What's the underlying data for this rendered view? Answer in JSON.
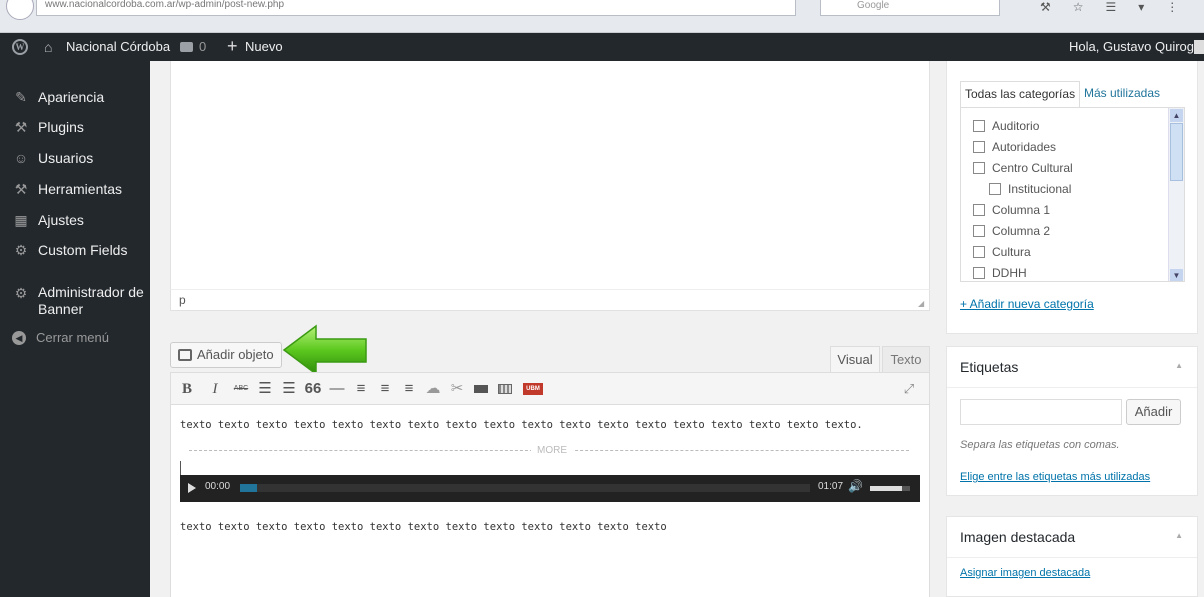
{
  "browser": {
    "url": "www.nacionalcordoba.com.ar/wp-admin/post-new.php",
    "search_placeholder": "Google",
    "toolbar_icons": [
      "tools-icon",
      "bookmark-icon",
      "menu-icon",
      "dropdown-icon",
      "more-icon"
    ]
  },
  "adminbar": {
    "site_name": "Nacional Córdoba",
    "comments_count": "0",
    "new_label": "Nuevo",
    "greeting": "Hola, Gustavo Quiroga"
  },
  "sidebar": {
    "items": [
      {
        "label": "Apariencia",
        "icon": "paintbrush-icon"
      },
      {
        "label": "Plugins",
        "icon": "plugin-icon"
      },
      {
        "label": "Usuarios",
        "icon": "users-icon"
      },
      {
        "label": "Herramientas",
        "icon": "wrench-icon"
      },
      {
        "label": "Ajustes",
        "icon": "settings-icon"
      },
      {
        "label": "Custom Fields",
        "icon": "gear-icon"
      },
      {
        "label": "Administrador de Banner",
        "icon": "gear-icon"
      }
    ],
    "collapse_label": "Cerrar menú"
  },
  "editor": {
    "status_path": "p",
    "add_media_label": "Añadir objeto",
    "tab_visual": "Visual",
    "tab_text": "Texto",
    "paragraph1": "texto texto texto texto texto texto texto texto texto texto texto texto texto texto texto texto texto texto.",
    "more_label": "MORE",
    "paragraph2": "texto texto texto texto texto texto texto texto texto texto texto texto texto",
    "toolbar_labels": {
      "bold": "B",
      "italic": "I",
      "strike": "ABC",
      "blockquote": "66",
      "hr": "—",
      "ubm": "UBM"
    },
    "player": {
      "current_time": "00:00",
      "total_time": "01:07",
      "progress": 0.03,
      "volume": 0.8
    }
  },
  "categories": {
    "tab_all": "Todas las categorías",
    "tab_popular": "Más utilizadas",
    "items": [
      {
        "label": "Auditorio",
        "checked": false,
        "child": false
      },
      {
        "label": "Autoridades",
        "checked": false,
        "child": false
      },
      {
        "label": "Centro Cultural",
        "checked": false,
        "child": false
      },
      {
        "label": "Institucional",
        "checked": false,
        "child": true
      },
      {
        "label": "Columna 1",
        "checked": false,
        "child": false
      },
      {
        "label": "Columna 2",
        "checked": false,
        "child": false
      },
      {
        "label": "Cultura",
        "checked": false,
        "child": false
      },
      {
        "label": "DDHH",
        "checked": false,
        "child": false
      }
    ],
    "add_new_link": "+ Añadir nueva categoría"
  },
  "tags": {
    "title": "Etiquetas",
    "add_button": "Añadir",
    "help_text": "Separa las etiquetas con comas.",
    "choose_link": "Elige entre las etiquetas más utilizadas"
  },
  "featured_image": {
    "title": "Imagen destacada",
    "set_link": "Asignar imagen destacada"
  },
  "colors": {
    "adminbar": "#23282d",
    "accent_link": "#0073aa",
    "arrow_green": "#5cc81e",
    "player_progress": "#21759b"
  }
}
